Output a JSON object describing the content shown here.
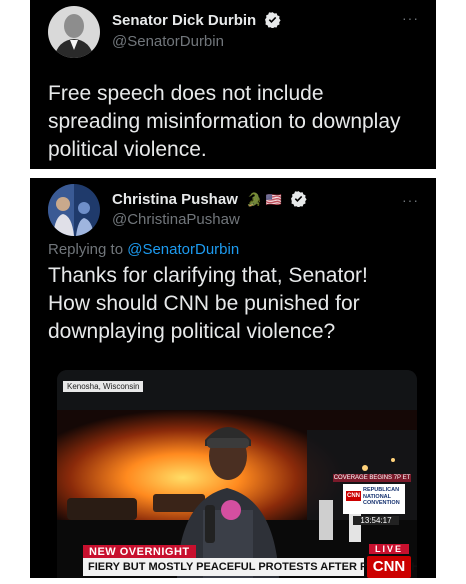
{
  "tweet1": {
    "name": "Senator Dick Durbin",
    "handle": "@SenatorDurbin",
    "more": "···",
    "text_lines": [
      "Free speech does not include",
      "spreading misinformation to downplay",
      "political violence."
    ]
  },
  "tweet2": {
    "name": "Christina Pushaw",
    "name_emojis": "🐊 🇺🇸",
    "handle": "@ChristinaPushaw",
    "more": "···",
    "replying_prefix": "Replying to ",
    "replying_to": "@SenatorDurbin",
    "text_lines": [
      "Thanks for clarifying that, Senator!",
      "How should CNN be punished for",
      "downplaying political violence?"
    ],
    "media": {
      "location": "Kenosha, Wisconsin",
      "coverage": "COVERAGE BEGINS 7P ET",
      "convention_logo": "CNN",
      "convention_text": [
        "REPUBLICAN",
        "NATIONAL",
        "CONVENTION"
      ],
      "time": "13:54:17",
      "live": "LIVE",
      "headline_tag": "NEW OVERNIGHT",
      "headline": "FIERY BUT MOSTLY PEACEFUL PROTESTS AFTER POLICE SHOOTING",
      "network_logo": "CNN"
    }
  },
  "colors": {
    "background": "#000000",
    "text": "#e7e9ea",
    "muted": "#71767b",
    "link": "#1d9bf0",
    "cnn_red": "#cc0000"
  }
}
